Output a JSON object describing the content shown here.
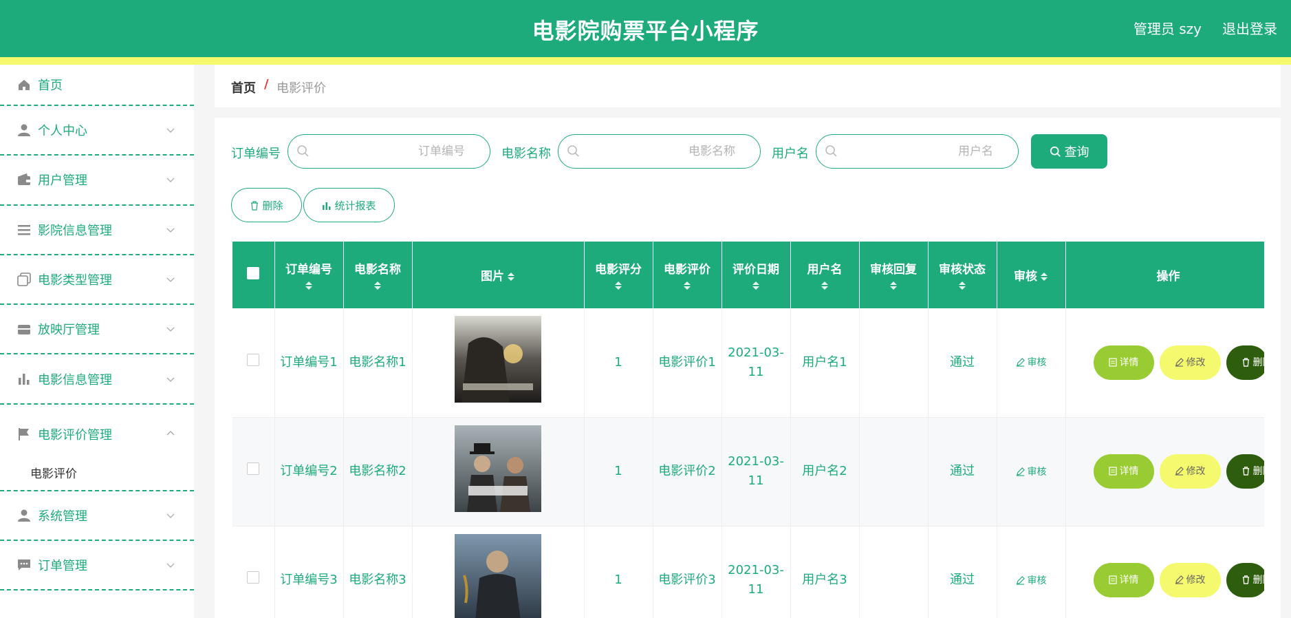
{
  "header": {
    "title": "电影院购票平台小程序",
    "user": "管理员 szy",
    "logout": "退出登录"
  },
  "sidebar": {
    "items": [
      {
        "label": "首页",
        "icon": "home-icon"
      },
      {
        "label": "个人中心",
        "icon": "person-icon"
      },
      {
        "label": "用户管理",
        "icon": "wallet-icon"
      },
      {
        "label": "影院信息管理",
        "icon": "list-icon"
      },
      {
        "label": "电影类型管理",
        "icon": "copy-icon"
      },
      {
        "label": "放映厅管理",
        "icon": "box-icon"
      },
      {
        "label": "电影信息管理",
        "icon": "bar-chart-icon"
      },
      {
        "label": "电影评价管理",
        "icon": "flag-icon",
        "sub": "电影评价"
      },
      {
        "label": "系统管理",
        "icon": "person-icon"
      },
      {
        "label": "订单管理",
        "icon": "chat-icon"
      }
    ]
  },
  "breadcrumb": {
    "home": "首页",
    "separator": "/",
    "current": "电影评价"
  },
  "search": {
    "order_label": "订单编号",
    "order_placeholder": "订单编号",
    "movie_label": "电影名称",
    "movie_placeholder": "电影名称",
    "user_label": "用户名",
    "user_placeholder": "用户名",
    "query_label": "查询"
  },
  "actions": {
    "delete_label": "删除",
    "report_label": "统计报表"
  },
  "table": {
    "columns": [
      "订单编号",
      "电影名称",
      "图片",
      "电影评分",
      "电影评价",
      "评价日期",
      "用户名",
      "审核回复",
      "审核状态",
      "审核",
      "操作"
    ],
    "rows": [
      {
        "order": "订单编号1",
        "movie": "电影名称1",
        "score": "1",
        "review": "电影评价1",
        "date": "2021-03-11",
        "user": "用户名1",
        "reply": "",
        "status": "通过",
        "audit": "审核"
      },
      {
        "order": "订单编号2",
        "movie": "电影名称2",
        "score": "1",
        "review": "电影评价2",
        "date": "2021-03-11",
        "user": "用户名2",
        "reply": "",
        "status": "通过",
        "audit": "审核"
      },
      {
        "order": "订单编号3",
        "movie": "电影名称3",
        "score": "1",
        "review": "电影评价3",
        "date": "2021-03-11",
        "user": "用户名3",
        "reply": "",
        "status": "通过",
        "audit": "审核"
      }
    ],
    "op_detail": "详情",
    "op_edit": "修改",
    "op_delete": "删除"
  },
  "colors": {
    "primary": "#1eab7b",
    "accent_yellow": "#f5f96e",
    "detail_green": "#99cc33",
    "delete_dark": "#2f5d0e"
  }
}
